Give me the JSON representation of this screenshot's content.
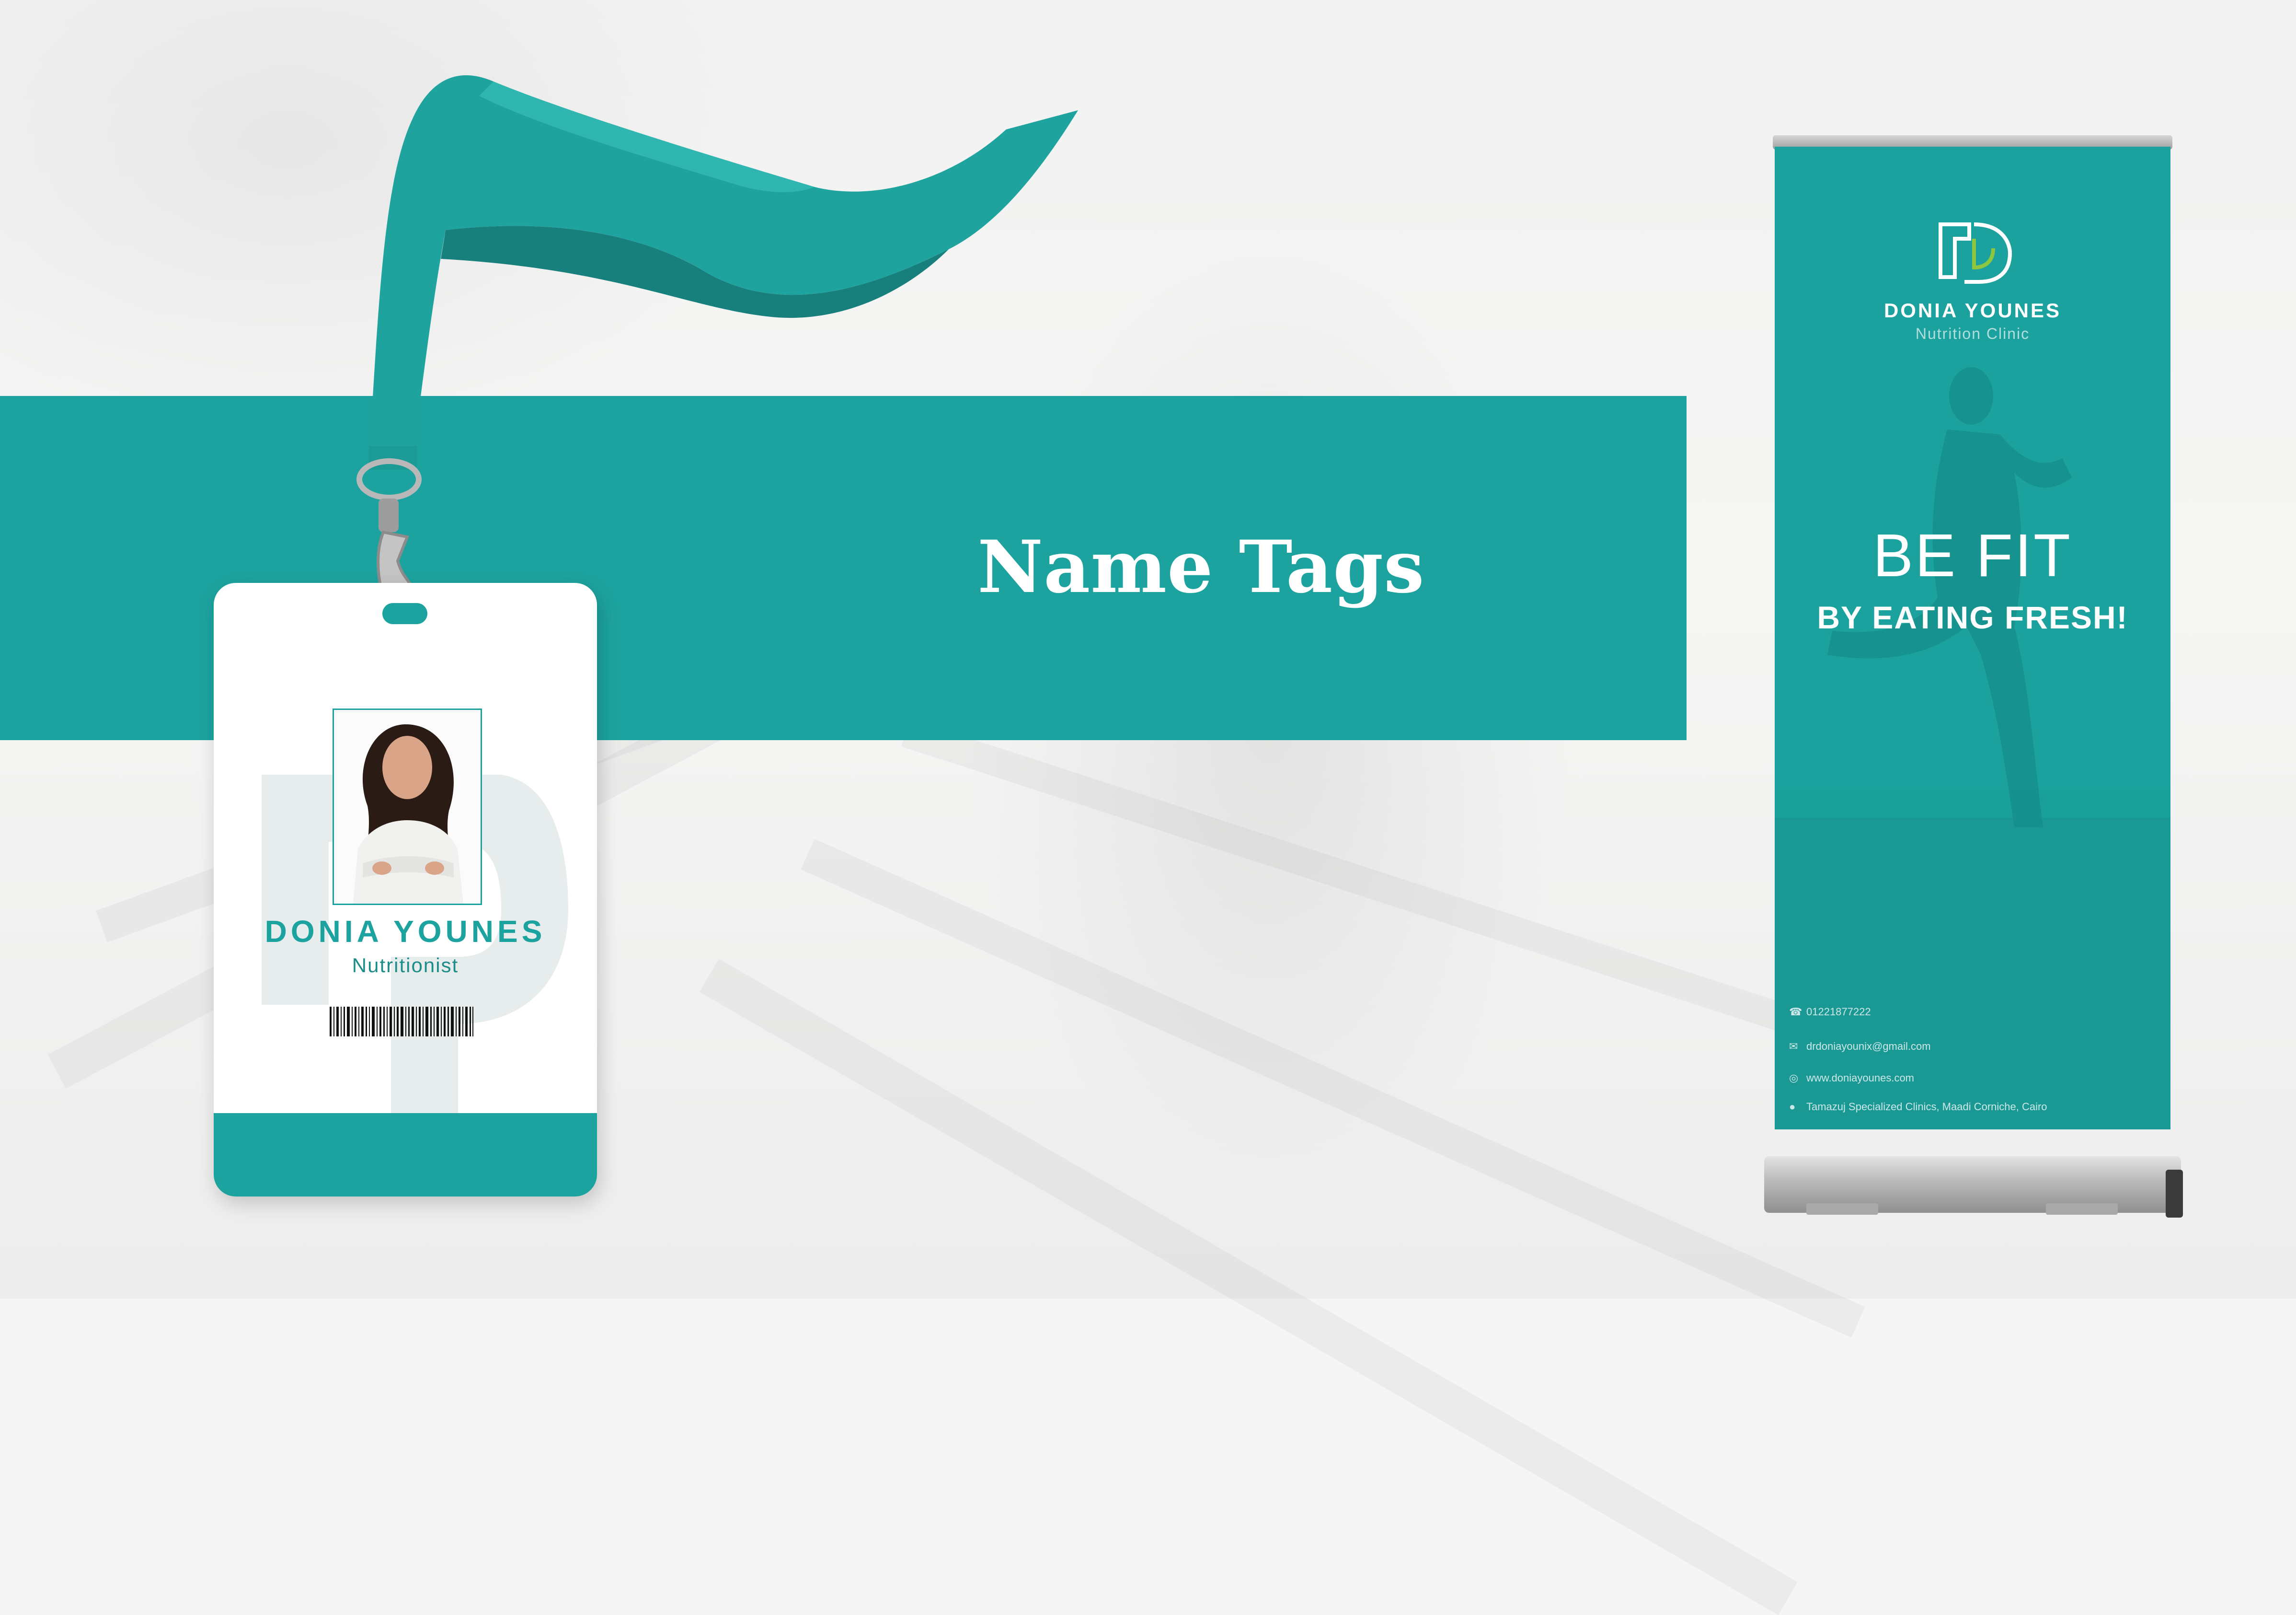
{
  "slide": {
    "title": "Name Tags"
  },
  "badge": {
    "name": "DONIA YOUNES",
    "role": "Nutritionist"
  },
  "rollup": {
    "brand": "DONIA YOUNES",
    "subtitle": "Nutrition Clinic",
    "headline": "BE FIT",
    "tagline": "BY EATING FRESH!",
    "contacts": [
      {
        "icon": "phone-icon",
        "text": "01221877222"
      },
      {
        "icon": "mail-icon",
        "text": "drdoniayounix@gmail.com"
      },
      {
        "icon": "globe-icon",
        "text": "www.doniayounes.com"
      },
      {
        "icon": "location-icon",
        "text": "Tamazuj Specialized Clinics, Maadi Corniche, Cairo"
      }
    ]
  },
  "colors": {
    "brand_teal": "#1da39f",
    "white": "#ffffff",
    "accent_green": "#8dc63f"
  }
}
